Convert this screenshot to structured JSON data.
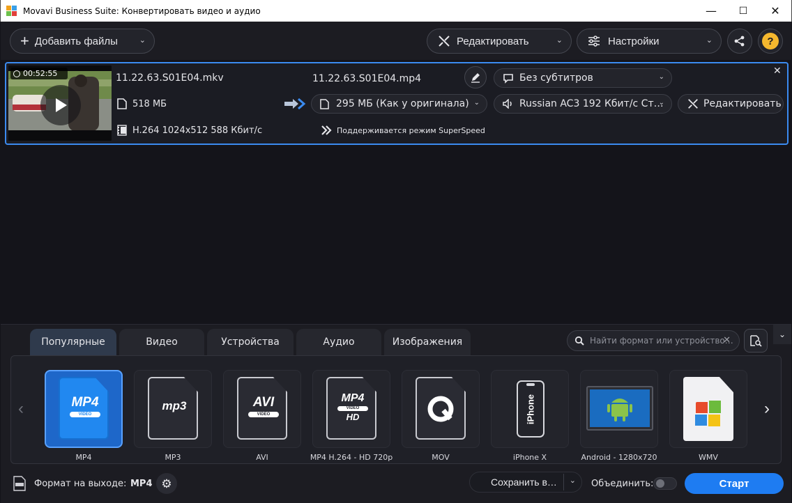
{
  "window": {
    "title": "Movavi Business Suite: Конвертировать видео и аудио",
    "minimize": "—",
    "maximize": "☐",
    "close": "✕"
  },
  "toolbar": {
    "add_files": "Добавить файлы",
    "edit": "Редактировать",
    "settings": "Настройки",
    "help": "?"
  },
  "file": {
    "duration": "00:52:55",
    "source_name": "11.22.63.S01E04.mkv",
    "source_size": "518 МБ",
    "source_codec": "H.264 1024x512 588 Кбит/с",
    "output_name": "11.22.63.S01E04.mp4",
    "output_size": "295 МБ (Как у оригинала)",
    "superspeed": "Поддерживается режим SuperSpeed",
    "subtitles": "Без субтитров",
    "audio": "Russian AC3 192 Кбит/с Ст…",
    "edit": "Редактировать"
  },
  "tabs": [
    "Популярные",
    "Видео",
    "Устройства",
    "Аудио",
    "Изображения"
  ],
  "search": {
    "placeholder": "Найти формат или устройство…"
  },
  "formats": [
    {
      "label": "MP4",
      "icon": "mp4-icon",
      "selected": true
    },
    {
      "label": "MP3",
      "icon": "mp3-icon"
    },
    {
      "label": "AVI",
      "icon": "avi-icon"
    },
    {
      "label": "MP4 H.264 - HD 720p",
      "icon": "mp4-hd-icon"
    },
    {
      "label": "MOV",
      "icon": "quicktime-icon"
    },
    {
      "label": "iPhone X",
      "icon": "iphone-icon"
    },
    {
      "label": "Android - 1280x720",
      "icon": "android-icon"
    },
    {
      "label": "WMV",
      "icon": "windows-icon"
    }
  ],
  "format_icon_text": {
    "mp4": "MP4",
    "mp4_sub": "VIDEO",
    "mp3": "mp3",
    "avi": "AVI",
    "avi_sub": "VIDEO",
    "hd": "MP4",
    "hd_sub": "VIDEO",
    "hd_hd": "HD",
    "iphone": "iPhone"
  },
  "footer": {
    "output_format_label": "Формат на выходе:",
    "output_format_value": "MP4",
    "save_to": "Сохранить в…",
    "merge_label": "Объединить:",
    "start": "Старт"
  },
  "colors": {
    "accent": "#1e7cf2",
    "selection_border": "#3b8bf0"
  }
}
